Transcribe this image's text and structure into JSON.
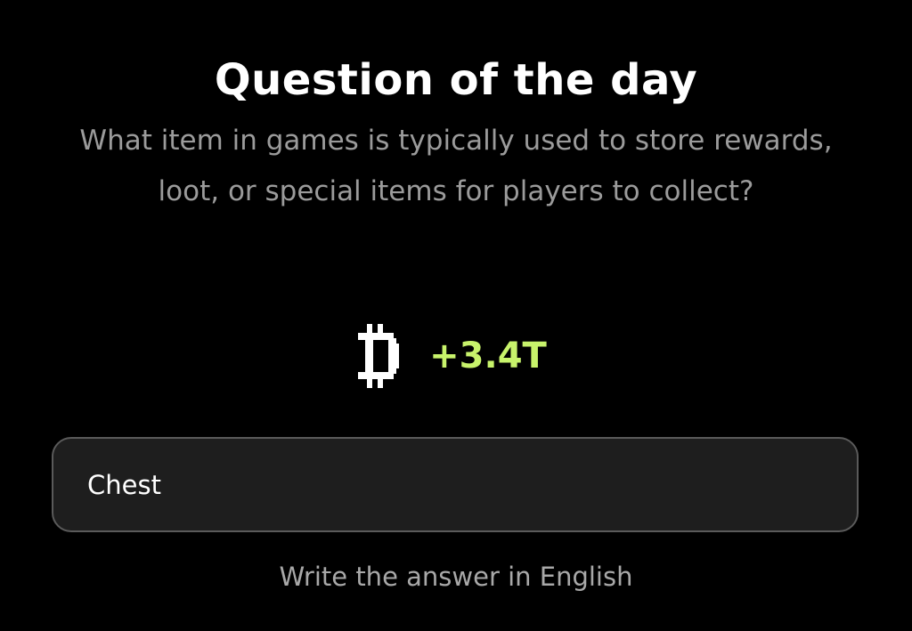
{
  "header": {
    "title": "Question of the day"
  },
  "question": {
    "text": "What item in games is typically used to store rewards, loot, or special items for players to collect?"
  },
  "reward": {
    "icon": "coin-icon",
    "amount": "+3.4T",
    "amount_color": "#c8f36b"
  },
  "answer": {
    "value": "Chest",
    "placeholder": ""
  },
  "hint": {
    "text": "Write the answer in English"
  }
}
